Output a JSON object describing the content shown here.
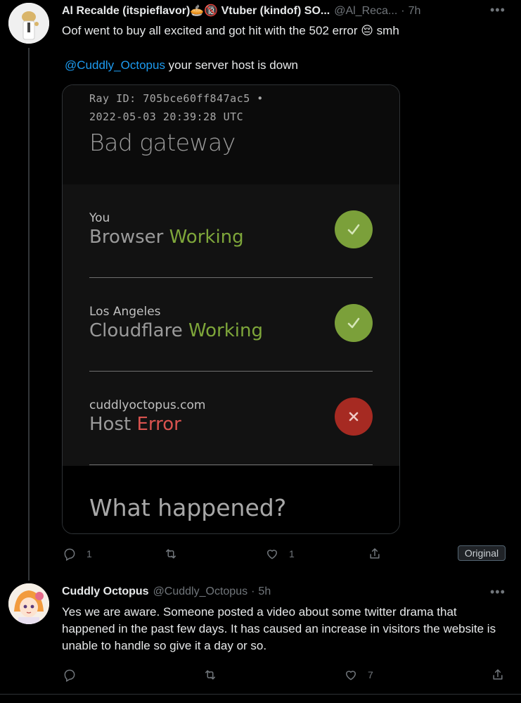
{
  "tweet1": {
    "name": "Al Recalde (itspieflavor)🥧🔞 Vtuber (kindof) SO...",
    "handle": "@Al_Reca...",
    "time": "7h",
    "more": "•••",
    "text_line1": "Oof went to buy all excited and got hit with the 502 error 😔 smh",
    "mention": "@Cuddly_Octopus",
    "text_line2": " your server host is down",
    "replies": "1",
    "retweets": "",
    "likes": "1",
    "original_label": "Original"
  },
  "card": {
    "ray_id": "Ray ID: 705bce60ff847ac5 •",
    "timestamp": "2022-05-03 20:39:28 UTC",
    "title": "Bad gateway",
    "rows": [
      {
        "location": "You",
        "label": "Browser",
        "status": "Working",
        "state": "ok",
        "icon": "check-icon"
      },
      {
        "location": "Los Angeles",
        "label": "Cloudflare",
        "status": "Working",
        "state": "ok",
        "icon": "check-icon"
      },
      {
        "location": "cuddlyoctopus.com",
        "label": "Host",
        "status": "Error",
        "state": "error",
        "icon": "x-icon"
      }
    ],
    "bottom_heading": "What happened?",
    "colors": {
      "ok": "#7ba03a",
      "error": "#a62a22"
    }
  },
  "tweet2": {
    "name": "Cuddly Octopus",
    "handle": "@Cuddly_Octopus",
    "time": "5h",
    "more": "•••",
    "text": "Yes we are aware. Someone posted a video about some twitter drama that happened in the past few days. It has caused an increase in visitors the website is unable to handle so give it a day or so.",
    "replies": "",
    "retweets": "",
    "likes": "7"
  },
  "colors": {
    "link": "#1d9bf0",
    "muted": "#71767b",
    "background": "#000000"
  }
}
